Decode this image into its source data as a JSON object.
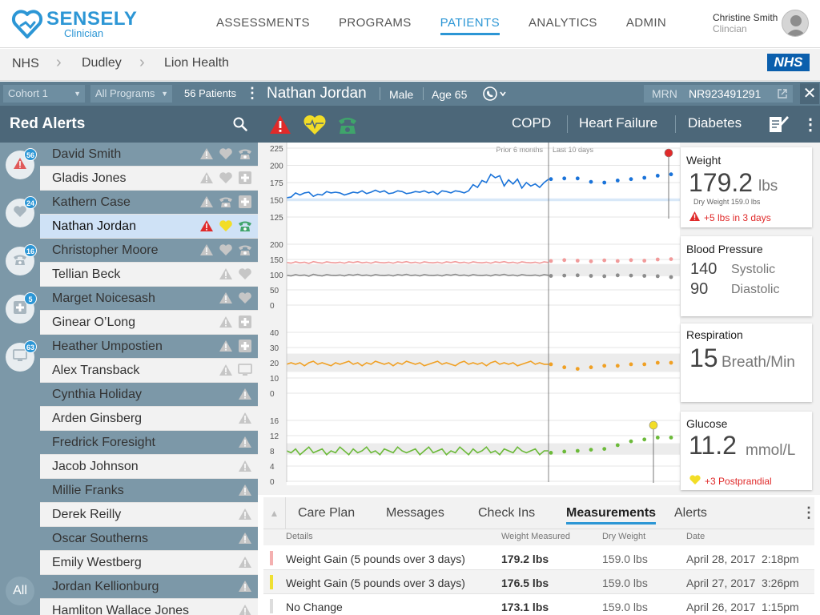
{
  "app": {
    "brand": "SENSELY",
    "subtitle": "Clinician"
  },
  "nav": [
    "ASSESSMENTS",
    "PROGRAMS",
    "PATIENTS",
    "ANALYTICS",
    "ADMIN"
  ],
  "nav_active": "PATIENTS",
  "user": {
    "name": "Christine Smith",
    "role": "Clincian"
  },
  "breadcrumb": [
    "NHS",
    "Dudley",
    "Lion Health"
  ],
  "nhs_logo": "NHS",
  "filters": {
    "cohort": "Cohort 1",
    "programs": "All Programs",
    "patient_count": "56 Patients"
  },
  "alerts_title": "Red Alerts",
  "rail": [
    {
      "icon": "alert-icon",
      "count": "56"
    },
    {
      "icon": "heart-icon",
      "count": "24"
    },
    {
      "icon": "phone-icon",
      "count": "16"
    },
    {
      "icon": "medical-plus-icon",
      "count": "5"
    },
    {
      "icon": "monitor-icon",
      "count": "63"
    }
  ],
  "rail_all": "All",
  "patients": [
    {
      "name": "David Smith",
      "icons": [
        "alert-icon",
        "heart-icon",
        "phone-icon"
      ]
    },
    {
      "name": "Gladis Jones",
      "icons": [
        "alert-icon",
        "heart-icon",
        "medical-plus-icon"
      ]
    },
    {
      "name": "Kathern Case",
      "icons": [
        "alert-icon",
        "phone-icon",
        "medical-plus-icon"
      ]
    },
    {
      "name": "Nathan Jordan",
      "icons": [
        "alert-icon",
        "heart-icon",
        "phone-icon"
      ],
      "selected": true
    },
    {
      "name": "Christopher Moore",
      "icons": [
        "alert-icon",
        "heart-icon",
        "phone-icon"
      ]
    },
    {
      "name": "Tellian Beck",
      "icons": [
        "alert-icon",
        "heart-icon"
      ]
    },
    {
      "name": "Marget Noicesash",
      "icons": [
        "alert-icon",
        "heart-icon"
      ]
    },
    {
      "name": "Ginear O’Long",
      "icons": [
        "alert-icon",
        "medical-plus-icon"
      ]
    },
    {
      "name": "Heather Umpostien",
      "icons": [
        "alert-icon",
        "medical-plus-icon"
      ]
    },
    {
      "name": "Alex Transback",
      "icons": [
        "alert-icon",
        "monitor-icon"
      ]
    },
    {
      "name": "Cynthia Holiday",
      "icons": [
        "alert-icon"
      ]
    },
    {
      "name": "Arden Ginsberg",
      "icons": [
        "alert-icon"
      ]
    },
    {
      "name": "Fredrick Foresight",
      "icons": [
        "alert-icon"
      ]
    },
    {
      "name": "Jacob Johnson",
      "icons": [
        "alert-icon"
      ]
    },
    {
      "name": "Millie Franks",
      "icons": [
        "alert-icon"
      ]
    },
    {
      "name": "Derek Reilly",
      "icons": [
        "alert-icon"
      ]
    },
    {
      "name": "Oscar Southerns",
      "icons": [
        "alert-icon"
      ]
    },
    {
      "name": "Emily Westberg",
      "icons": [
        "alert-icon"
      ]
    },
    {
      "name": "Jordan Kellionburg",
      "icons": [
        "alert-icon"
      ]
    },
    {
      "name": "Hamliton Wallace Jones",
      "icons": [
        "alert-icon"
      ]
    }
  ],
  "patient": {
    "name": "Nathan Jordan",
    "sex": "Male",
    "age": "Age 65",
    "mrn_label": "MRN",
    "mrn": "NR923491291"
  },
  "conditions": [
    "COPD",
    "Heart Failure",
    "Diabetes"
  ],
  "colors": {
    "red": "#e02a2a",
    "yellow": "#f2dd27",
    "green": "#3fa46b",
    "blue": "#1a73d9",
    "pink": "#f19a9a",
    "gray": "#8c8c8c",
    "orange": "#f0a024",
    "lime": "#6cba3a",
    "accent": "#2c96d5"
  },
  "period_labels": {
    "prior": "Prior 6 months",
    "recent": "Last 10 days"
  },
  "chart_data": [
    {
      "type": "line",
      "title": "Weight",
      "y_ticks": [
        "225",
        "200",
        "175",
        "150",
        "125"
      ],
      "ylim": [
        125,
        225
      ],
      "normal_range": [
        148,
        152
      ],
      "series": [
        {
          "color": "blue",
          "values": [
            153,
            154,
            160,
            157,
            160,
            161,
            155,
            158,
            157,
            162,
            160,
            161,
            160,
            157,
            159,
            161,
            160,
            163,
            159,
            161,
            164,
            161,
            163,
            159,
            160,
            163,
            162,
            159,
            160,
            162,
            161,
            163,
            160,
            162,
            158,
            163,
            162,
            160,
            163,
            162,
            160,
            163,
            172,
            168,
            178,
            175,
            187,
            182,
            185,
            170,
            179,
            173,
            180,
            167,
            175,
            170,
            173,
            168,
            175,
            180
          ],
          "recent": [
            180,
            181,
            181,
            176,
            175,
            178,
            180,
            182,
            185,
            187
          ]
        }
      ],
      "marker": {
        "color": "red",
        "x": "end"
      }
    },
    {
      "type": "line",
      "title": "Blood Pressure",
      "y_ticks": [
        "200",
        "150",
        "100",
        "50",
        "0"
      ],
      "ylim": [
        0,
        200
      ],
      "normal_range": [
        95,
        135
      ],
      "series": [
        {
          "color": "pink",
          "values": [
            140,
            138,
            142,
            139,
            141,
            137,
            143,
            140,
            138,
            142,
            140,
            139,
            141,
            138,
            142,
            140,
            143,
            139,
            141,
            138,
            142,
            140,
            139,
            141,
            138,
            142,
            140,
            143,
            139,
            141,
            138,
            142,
            140,
            139,
            141,
            138,
            142,
            140,
            143,
            139,
            141,
            138,
            142,
            140,
            139,
            141,
            138,
            142,
            140,
            143,
            139,
            141,
            138,
            142,
            140,
            139,
            141,
            138,
            142,
            140
          ],
          "recent": [
            145,
            148,
            146,
            144,
            147,
            145,
            148,
            146,
            150,
            151
          ]
        },
        {
          "color": "gray",
          "values": [
            98,
            96,
            100,
            97,
            99,
            95,
            101,
            98,
            96,
            100,
            98,
            97,
            99,
            96,
            100,
            98,
            101,
            97,
            99,
            96,
            100,
            98,
            97,
            99,
            96,
            100,
            98,
            101,
            97,
            99,
            96,
            100,
            98,
            97,
            99,
            96,
            100,
            98,
            101,
            97,
            99,
            96,
            100,
            98,
            97,
            99,
            96,
            100,
            98,
            101,
            97,
            99,
            96,
            100,
            98,
            97,
            99,
            96,
            100,
            98
          ],
          "recent": [
            96,
            97,
            98,
            96,
            95,
            98,
            97,
            96,
            95,
            92
          ]
        }
      ]
    },
    {
      "type": "line",
      "title": "Respiration",
      "y_ticks": [
        "40",
        "30",
        "20",
        "10",
        "0"
      ],
      "ylim": [
        0,
        40
      ],
      "normal_range": [
        14,
        26
      ],
      "series": [
        {
          "color": "orange",
          "values": [
            19,
            20,
            19,
            20,
            18,
            20,
            21,
            19,
            20,
            19,
            18,
            20,
            19,
            20,
            21,
            19,
            20,
            18,
            20,
            19,
            21,
            20,
            19,
            20,
            18,
            20,
            19,
            21,
            20,
            19,
            20,
            18,
            19,
            20,
            21,
            19,
            20,
            19,
            18,
            20,
            21,
            19,
            20,
            19,
            20,
            18,
            20,
            21,
            19,
            20,
            19,
            20,
            18,
            19,
            20,
            21,
            19,
            20,
            19,
            19
          ],
          "recent": [
            19,
            17,
            16,
            17,
            18,
            18,
            19,
            19,
            20,
            20
          ]
        }
      ]
    },
    {
      "type": "line",
      "title": "Glucose",
      "y_ticks": [
        "16",
        "12",
        "8",
        "4",
        "0"
      ],
      "ylim": [
        0,
        16
      ],
      "normal_range": [
        7,
        10
      ],
      "series": [
        {
          "color": "lime",
          "values": [
            8,
            7.5,
            8.5,
            7,
            8,
            9,
            7.5,
            8,
            8.5,
            7,
            8,
            7.5,
            9,
            8,
            7,
            8.5,
            7.5,
            8,
            9,
            7.5,
            8,
            7,
            8.5,
            8,
            7.5,
            9,
            8,
            7.5,
            8,
            8.5,
            7,
            8,
            9,
            7.5,
            8,
            8.5,
            7,
            8,
            7.5,
            9,
            8,
            7,
            8.5,
            7.5,
            8,
            9,
            7.5,
            8,
            7,
            8.5,
            8,
            7.5,
            9,
            8,
            7.5,
            8,
            8.5,
            7,
            8,
            8
          ],
          "recent": [
            7.5,
            7.8,
            8,
            8.3,
            8.5,
            9.5,
            10.5,
            11,
            11.5,
            11.5
          ]
        }
      ],
      "marker": {
        "color": "yellow",
        "x": "late"
      }
    }
  ],
  "cards": {
    "weight": {
      "title": "Weight",
      "value": "179.2",
      "unit": "lbs",
      "dry": "Dry Weight 159.0 lbs",
      "alert": "+5 lbs in 3 days"
    },
    "bp": {
      "title": "Blood Pressure",
      "systolic": "140",
      "systolic_label": "Systolic",
      "diastolic": "90",
      "diastolic_label": "Diastolic"
    },
    "resp": {
      "title": "Respiration",
      "value": "15",
      "unit": "Breath/Min"
    },
    "glucose": {
      "title": "Glucose",
      "value": "11.2",
      "unit": "mmol/L",
      "alert": "+3 Postprandial"
    }
  },
  "tabs": [
    "Care Plan",
    "Messages",
    "Check Ins",
    "Measurements",
    "Alerts"
  ],
  "tab_active": "Measurements",
  "table": {
    "headers": [
      "Details",
      "Weight Measured",
      "Dry Weight",
      "Date"
    ],
    "rows": [
      {
        "detail": "Weight Gain (5 pounds over 3 days)",
        "measured": "179.2 lbs",
        "dry": "159.0 lbs",
        "date": "April 28, 2017",
        "time": "2:18pm",
        "mark": "#f4b0b0"
      },
      {
        "detail": "Weight Gain (5 pounds over 3 days)",
        "measured": "176.5  lbs",
        "dry": "159.0 lbs",
        "date": "April 27, 2017",
        "time": "3:26pm",
        "mark": "#efe033"
      },
      {
        "detail": "No Change",
        "measured": "173.1 lbs",
        "dry": "159.0 lbs",
        "date": "April 26, 2017",
        "time": "1:15pm",
        "mark": "#dddddd"
      }
    ]
  }
}
